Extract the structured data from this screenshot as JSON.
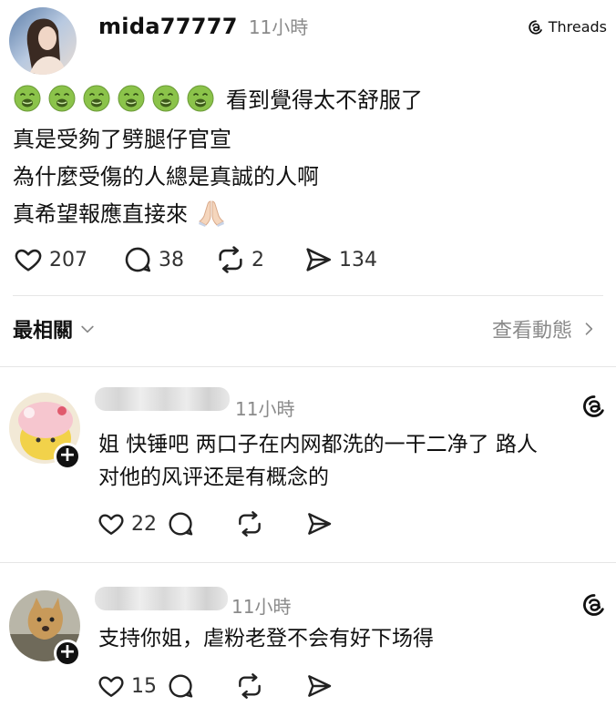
{
  "post": {
    "username": "mida77777",
    "time": "11小時",
    "brand": "Threads",
    "lines": [
      "看到覺得太不舒服了",
      "真是受夠了劈腿仔官宣",
      "為什麼受傷的人總是真誠的人啊",
      "真希望報應直接來"
    ],
    "emojis": [
      "nauseated-face",
      "nauseated-face",
      "nauseated-face",
      "nauseated-face",
      "nauseated-face",
      "nauseated-face"
    ],
    "end_emoji": "folded-hands",
    "stats": {
      "likes": "207",
      "comments": "38",
      "reposts": "2",
      "shares": "134"
    }
  },
  "filter": {
    "label": "最相關",
    "view_activity": "查看動態"
  },
  "replies": [
    {
      "time": "11小時",
      "text_lines": [
        "姐 快锤吧 两口子在内网都洗的一干二净了 路人",
        "对他的风评还是有概念的"
      ],
      "likes": "22"
    },
    {
      "time": "11小時",
      "text_lines": [
        "支持你姐，虐粉老登不会有好下场得"
      ],
      "likes": "15"
    }
  ],
  "colors": {
    "text": "#111111",
    "muted": "#8a8a8a",
    "divider": "#e6e6e6",
    "emoji_green": "#8bc34a"
  }
}
